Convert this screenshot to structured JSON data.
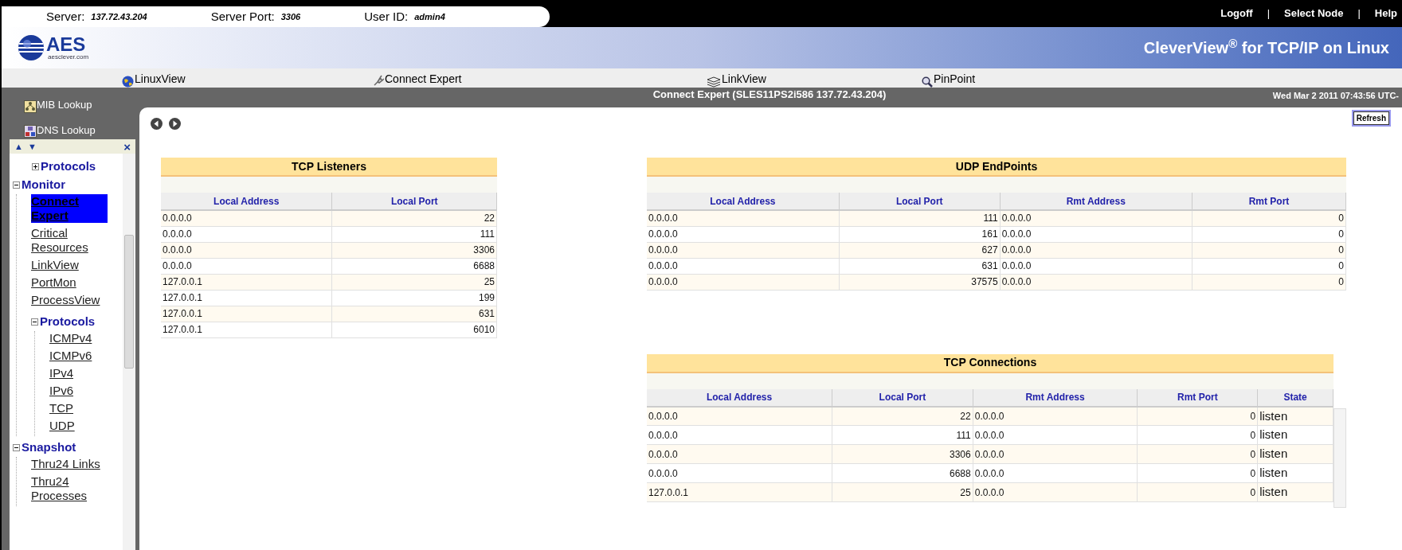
{
  "server_info": [
    {
      "label": "Server:",
      "value": "137.72.43.204"
    },
    {
      "label": "Server Port:",
      "value": "3306"
    },
    {
      "label": "User ID:",
      "value": "admin4"
    }
  ],
  "top_links": [
    {
      "kind": "link",
      "label": "Logoff"
    },
    {
      "kind": "separator",
      "label": "|"
    },
    {
      "kind": "link",
      "label": "Select Node"
    },
    {
      "kind": "separator",
      "label": "|"
    },
    {
      "kind": "link",
      "label": "Help"
    }
  ],
  "logo": {
    "name": "AES",
    "site": "aesclever.com"
  },
  "app_title": "CleverView$^{®}$ for TCP/IP on Linux",
  "nav": [
    {
      "kind": "globe",
      "label": "LinuxView"
    },
    {
      "kind": "plug",
      "label": "Connect Expert"
    },
    {
      "kind": "layers",
      "label": "LinkView"
    },
    {
      "kind": "magnifier",
      "label": "PinPoint"
    }
  ],
  "page_title": "Connect Expert (SLES11PS2i586 137.72.43.204)",
  "timestamp": "Wed  Mar 2 2011 07:43:56 UTC-",
  "tools": [
    {
      "kind": "mib",
      "label": "MIB Lookup"
    },
    {
      "kind": "dns",
      "label": "DNS Lookup"
    }
  ],
  "tree_toolbar": {
    "up": "▲",
    "down": "▼",
    "close": "×"
  },
  "tree_partial": [
    {
      "kind": "group",
      "label": "Protocols",
      "expanded": false
    }
  ],
  "tree": [
    {
      "kind": "group",
      "label": "Monitor",
      "expanded": true,
      "children": [
        {
          "kind": "link",
          "label": "Connect Expert",
          "selected": true
        },
        {
          "kind": "link",
          "label": "Critical Resources",
          "selected": false
        },
        {
          "kind": "link",
          "label": "LinkView",
          "selected": false
        },
        {
          "kind": "link",
          "label": "PortMon",
          "selected": false
        },
        {
          "kind": "link",
          "label": "ProcessView",
          "selected": false
        },
        {
          "kind": "group",
          "label": "Protocols",
          "expanded": true,
          "children": [
            {
              "kind": "link",
              "label": "ICMPv4",
              "selected": false
            },
            {
              "kind": "link",
              "label": "ICMPv6",
              "selected": false
            },
            {
              "kind": "link",
              "label": "IPv4",
              "selected": false
            },
            {
              "kind": "link",
              "label": "IPv6",
              "selected": false
            },
            {
              "kind": "link",
              "label": "TCP",
              "selected": false
            },
            {
              "kind": "link",
              "label": "UDP",
              "selected": false
            }
          ]
        }
      ]
    },
    {
      "kind": "group",
      "label": "Snapshot",
      "expanded": true,
      "children": [
        {
          "kind": "link",
          "label": "Thru24 Links",
          "selected": false
        },
        {
          "kind": "link",
          "label": "Thru24 Processes",
          "selected": false
        }
      ]
    }
  ],
  "refresh_button": "Refresh",
  "tables": [
    {
      "title": "TCP Listeners",
      "columns": [
        {
          "label": "Local Address",
          "kind": "text"
        },
        {
          "label": "Local Port",
          "kind": "number"
        }
      ],
      "rows": [
        [
          "0.0.0.0",
          "22"
        ],
        [
          "0.0.0.0",
          "111"
        ],
        [
          "0.0.0.0",
          "3306"
        ],
        [
          "0.0.0.0",
          "6688"
        ],
        [
          "127.0.0.1",
          "25"
        ],
        [
          "127.0.0.1",
          "199"
        ],
        [
          "127.0.0.1",
          "631"
        ],
        [
          "127.0.0.1",
          "6010"
        ]
      ]
    },
    {
      "title": "UDP EndPoints",
      "columns": [
        {
          "label": "Local Address",
          "kind": "text"
        },
        {
          "label": "Local Port",
          "kind": "number"
        },
        {
          "label": "Rmt Address",
          "kind": "text"
        },
        {
          "label": "Rmt Port",
          "kind": "number"
        }
      ],
      "rows": [
        [
          "0.0.0.0",
          "111",
          "0.0.0.0",
          "0"
        ],
        [
          "0.0.0.0",
          "161",
          "0.0.0.0",
          "0"
        ],
        [
          "0.0.0.0",
          "627",
          "0.0.0.0",
          "0"
        ],
        [
          "0.0.0.0",
          "631",
          "0.0.0.0",
          "0"
        ],
        [
          "0.0.0.0",
          "37575",
          "0.0.0.0",
          "0"
        ]
      ]
    },
    {
      "title": "TCP Connections",
      "columns": [
        {
          "label": "Local Address",
          "kind": "text"
        },
        {
          "label": "Local Port",
          "kind": "number"
        },
        {
          "label": "Rmt Address",
          "kind": "text"
        },
        {
          "label": "Rmt Port",
          "kind": "number"
        },
        {
          "label": "State",
          "kind": "state"
        }
      ],
      "rows": [
        [
          "0.0.0.0",
          "22",
          "0.0.0.0",
          "0",
          "listen"
        ],
        [
          "0.0.0.0",
          "111",
          "0.0.0.0",
          "0",
          "listen"
        ],
        [
          "0.0.0.0",
          "3306",
          "0.0.0.0",
          "0",
          "listen"
        ],
        [
          "0.0.0.0",
          "6688",
          "0.0.0.0",
          "0",
          "listen"
        ],
        [
          "127.0.0.1",
          "25",
          "0.0.0.0",
          "0",
          "listen"
        ]
      ]
    }
  ]
}
